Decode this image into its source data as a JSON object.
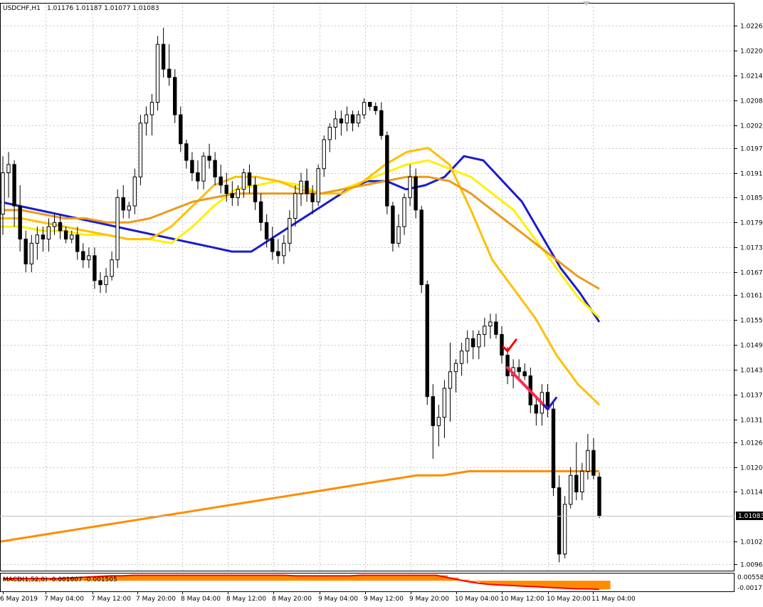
{
  "header": {
    "symbol_label": "USDCHF,H1",
    "ohlc_label": "1.01176 1.01187 1.01077 1.01083"
  },
  "macd_label": "MACD(1,52,0) -0.001607 -0.001505",
  "colors": {
    "background": "#ffffff",
    "grid": "#c8c8c8",
    "axis": "#000000",
    "bull_fill": "#ffffff",
    "bear_fill": "#000000",
    "ma_blue": "#1c1ccc",
    "ma_yellow": "#fff000",
    "ma_gold": "#ffc000",
    "ma_orange": "#ec9a1c",
    "ma_long": "#ff8c00",
    "macd_line": "#ff0000",
    "macd_hist": "#ff8c00",
    "price_tag_bg": "#000000",
    "price_tag_text": "#ffffff"
  },
  "chart_data": [
    {
      "type": "candlestick",
      "title": "USDCHF,H1",
      "ylim": [
        1.0095,
        1.0232
      ],
      "y_ticks": [
        "1.02265",
        "1.02205",
        "1.02145",
        "1.02085",
        "1.02025",
        "1.01970",
        "1.01910",
        "1.01850",
        "1.01790",
        "1.01730",
        "1.01670",
        "1.01615",
        "1.01555",
        "1.01495",
        "1.01435",
        "1.01375",
        "1.01315",
        "1.01260",
        "1.01200",
        "1.01140",
        "1.01020",
        "1.00965"
      ],
      "current_price": "1.01083",
      "x_ticks": [
        "6 May 2019",
        "7 May 04:00",
        "7 May 12:00",
        "7 May 20:00",
        "8 May 04:00",
        "8 May 12:00",
        "8 May 20:00",
        "9 May 04:00",
        "9 May 12:00",
        "9 May 20:00",
        "10 May 04:00",
        "10 May 12:00",
        "10 May 20:00",
        "11 May 04:00"
      ],
      "candles": [
        [
          1.0181,
          1.0195,
          1.0176,
          1.0191
        ],
        [
          1.0191,
          1.0196,
          1.0185,
          1.0193
        ],
        [
          1.0193,
          1.0194,
          1.0178,
          1.0183
        ],
        [
          1.0183,
          1.0188,
          1.0172,
          1.0175
        ],
        [
          1.0175,
          1.0177,
          1.0167,
          1.0169
        ],
        [
          1.0169,
          1.0176,
          1.0167,
          1.0174
        ],
        [
          1.0174,
          1.0178,
          1.017,
          1.0176
        ],
        [
          1.0176,
          1.0178,
          1.0172,
          1.0175
        ],
        [
          1.0175,
          1.018,
          1.0172,
          1.0178
        ],
        [
          1.0178,
          1.0181,
          1.0176,
          1.0179
        ],
        [
          1.0179,
          1.0181,
          1.0175,
          1.0177
        ],
        [
          1.0177,
          1.0178,
          1.0174,
          1.0175
        ],
        [
          1.0175,
          1.0177,
          1.0174,
          1.0176
        ],
        [
          1.0176,
          1.0178,
          1.017,
          1.0172
        ],
        [
          1.0172,
          1.0174,
          1.0168,
          1.017
        ],
        [
          1.017,
          1.0173,
          1.0168,
          1.0171
        ],
        [
          1.0171,
          1.0173,
          1.0163,
          1.0165
        ],
        [
          1.0165,
          1.0167,
          1.0162,
          1.0164
        ],
        [
          1.0164,
          1.0168,
          1.0162,
          1.0166
        ],
        [
          1.0166,
          1.0172,
          1.0165,
          1.017
        ],
        [
          1.017,
          1.0187,
          1.0168,
          1.0185
        ],
        [
          1.0185,
          1.0188,
          1.018,
          1.0182
        ],
        [
          1.0182,
          1.0184,
          1.018,
          1.0183
        ],
        [
          1.0183,
          1.0192,
          1.0181,
          1.019
        ],
        [
          1.019,
          1.0205,
          1.0188,
          1.0203
        ],
        [
          1.0203,
          1.0207,
          1.02,
          1.0205
        ],
        [
          1.0205,
          1.021,
          1.02,
          1.0208
        ],
        [
          1.0208,
          1.0224,
          1.0206,
          1.0222
        ],
        [
          1.0222,
          1.0226,
          1.0214,
          1.0216
        ],
        [
          1.0216,
          1.0222,
          1.0212,
          1.0214
        ],
        [
          1.0214,
          1.0216,
          1.0203,
          1.0205
        ],
        [
          1.0205,
          1.0207,
          1.0196,
          1.0198
        ],
        [
          1.0198,
          1.0199,
          1.0192,
          1.0194
        ],
        [
          1.0194,
          1.0196,
          1.0189,
          1.0191
        ],
        [
          1.0191,
          1.0194,
          1.0187,
          1.0189
        ],
        [
          1.0189,
          1.0196,
          1.0187,
          1.0195
        ],
        [
          1.0195,
          1.0198,
          1.0192,
          1.0194
        ],
        [
          1.0194,
          1.0196,
          1.0188,
          1.019
        ],
        [
          1.019,
          1.0193,
          1.0186,
          1.0188
        ],
        [
          1.0188,
          1.0191,
          1.0184,
          1.0186
        ],
        [
          1.0186,
          1.0189,
          1.0183,
          1.0185
        ],
        [
          1.0185,
          1.0188,
          1.0183,
          1.0187
        ],
        [
          1.0187,
          1.0192,
          1.0185,
          1.0191
        ],
        [
          1.0191,
          1.0193,
          1.0186,
          1.0188
        ],
        [
          1.0188,
          1.019,
          1.0182,
          1.0184
        ],
        [
          1.0184,
          1.0186,
          1.0177,
          1.0179
        ],
        [
          1.0179,
          1.0181,
          1.0173,
          1.0175
        ],
        [
          1.0175,
          1.0178,
          1.017,
          1.0172
        ],
        [
          1.0172,
          1.0175,
          1.0169,
          1.0171
        ],
        [
          1.0171,
          1.0176,
          1.0169,
          1.0174
        ],
        [
          1.0174,
          1.0182,
          1.0172,
          1.018
        ],
        [
          1.018,
          1.0188,
          1.0178,
          1.0186
        ],
        [
          1.0186,
          1.0191,
          1.0183,
          1.0189
        ],
        [
          1.0189,
          1.0192,
          1.0184,
          1.0186
        ],
        [
          1.0186,
          1.0188,
          1.0181,
          1.0184
        ],
        [
          1.0184,
          1.0193,
          1.0183,
          1.0192
        ],
        [
          1.0192,
          1.02,
          1.019,
          1.0199
        ],
        [
          1.0199,
          1.0203,
          1.0196,
          1.0202
        ],
        [
          1.0202,
          1.0206,
          1.0199,
          1.0204
        ],
        [
          1.0204,
          1.0206,
          1.02,
          1.0203
        ],
        [
          1.0203,
          1.0207,
          1.0201,
          1.0205
        ],
        [
          1.0205,
          1.0206,
          1.0201,
          1.0203
        ],
        [
          1.0203,
          1.0206,
          1.0202,
          1.0205
        ],
        [
          1.0205,
          1.0209,
          1.0204,
          1.0208
        ],
        [
          1.0208,
          1.0208,
          1.0206,
          1.0207
        ],
        [
          1.0207,
          1.0208,
          1.0205,
          1.0206
        ],
        [
          1.0206,
          1.0208,
          1.0199,
          1.02
        ],
        [
          1.02,
          1.0201,
          1.0181,
          1.0183
        ],
        [
          1.0183,
          1.0184,
          1.0172,
          1.0174
        ],
        [
          1.0174,
          1.0181,
          1.0173,
          1.0178
        ],
        [
          1.0178,
          1.0186,
          1.0176,
          1.0185
        ],
        [
          1.0185,
          1.0193,
          1.0183,
          1.019
        ],
        [
          1.019,
          1.0192,
          1.018,
          1.0182
        ],
        [
          1.0182,
          1.0183,
          1.0162,
          1.0164
        ],
        [
          1.0164,
          1.0165,
          1.0135,
          1.0137
        ],
        [
          1.0137,
          1.014,
          1.0122,
          1.013
        ],
        [
          1.013,
          1.0135,
          1.0125,
          1.0132
        ],
        [
          1.0132,
          1.0141,
          1.0127,
          1.0139
        ],
        [
          1.0139,
          1.015,
          1.0131,
          1.0143
        ],
        [
          1.0143,
          1.0146,
          1.0138,
          1.0145
        ],
        [
          1.0145,
          1.015,
          1.0142,
          1.0148
        ],
        [
          1.0148,
          1.0153,
          1.0145,
          1.0151
        ],
        [
          1.0151,
          1.0153,
          1.0146,
          1.0149
        ],
        [
          1.0149,
          1.0153,
          1.0146,
          1.0152
        ],
        [
          1.0152,
          1.0156,
          1.0149,
          1.0154
        ],
        [
          1.0154,
          1.0157,
          1.0151,
          1.0155
        ],
        [
          1.0155,
          1.0157,
          1.0151,
          1.0152
        ],
        [
          1.0152,
          1.0154,
          1.0145,
          1.0147
        ],
        [
          1.0147,
          1.0149,
          1.014,
          1.0142
        ],
        [
          1.0142,
          1.0146,
          1.0139,
          1.0144
        ],
        [
          1.0144,
          1.0146,
          1.0141,
          1.0143
        ],
        [
          1.0143,
          1.0145,
          1.0141,
          1.0142
        ],
        [
          1.0142,
          1.0144,
          1.0133,
          1.0135
        ],
        [
          1.0135,
          1.0137,
          1.013,
          1.0133
        ],
        [
          1.0133,
          1.014,
          1.013,
          1.0138
        ],
        [
          1.0138,
          1.014,
          1.0132,
          1.0134
        ],
        [
          1.0134,
          1.0136,
          1.0113,
          1.0115
        ],
        [
          1.0115,
          1.0118,
          1.0097,
          1.0099
        ],
        [
          1.0099,
          1.0113,
          1.0098,
          1.0111
        ],
        [
          1.0111,
          1.012,
          1.011,
          1.0118
        ],
        [
          1.0118,
          1.0126,
          1.0112,
          1.0114
        ],
        [
          1.0114,
          1.0121,
          1.0112,
          1.0119
        ],
        [
          1.0119,
          1.0128,
          1.0117,
          1.0124
        ],
        [
          1.0124,
          1.0127,
          1.0117,
          1.0118
        ],
        [
          1.01176,
          1.01187,
          1.01077,
          1.01083
        ]
      ],
      "moving_averages": [
        {
          "color_key": "ma_blue",
          "values": [
            1.0184,
            1.0183,
            1.0182,
            1.0181,
            1.018,
            1.0179,
            1.0178,
            1.0177,
            1.0176,
            1.0175,
            1.0174,
            1.0173,
            1.0172,
            1.0172,
            1.0175,
            1.0178,
            1.0181,
            1.0184,
            1.0187,
            1.0189,
            1.0189,
            1.0187,
            1.0188,
            1.019,
            1.0195,
            1.0194,
            1.0189,
            1.0184,
            1.0176,
            1.0168,
            1.0162,
            1.0155
          ]
        },
        {
          "color_key": "ma_yellow",
          "values": [
            1.0178,
            1.0178,
            1.0177,
            1.0177,
            1.0176,
            1.0176,
            1.0175,
            1.0175,
            1.0174,
            1.0178,
            1.0183,
            1.0187,
            1.0188,
            1.0189,
            1.0188,
            1.0186,
            1.0187,
            1.0189,
            1.0191,
            1.0193,
            1.0194,
            1.0192,
            1.019,
            1.0186,
            1.0182,
            1.0175,
            1.0168,
            1.0161,
            1.0156
          ]
        },
        {
          "color_key": "ma_gold",
          "values": [
            1.018,
            1.018,
            1.0179,
            1.0178,
            1.0177,
            1.0176,
            1.0175,
            1.0175,
            1.0178,
            1.0183,
            1.0188,
            1.019,
            1.019,
            1.0189,
            1.0187,
            1.0186,
            1.0186,
            1.0189,
            1.0193,
            1.0196,
            1.0197,
            1.0193,
            1.0182,
            1.017,
            1.0163,
            1.0156,
            1.0147,
            1.014,
            1.0135
          ]
        },
        {
          "color_key": "ma_orange",
          "values": [
            1.0182,
            1.0182,
            1.0181,
            1.018,
            1.018,
            1.0179,
            1.0179,
            1.018,
            1.0182,
            1.0184,
            1.0185,
            1.0186,
            1.0186,
            1.0186,
            1.0186,
            1.0186,
            1.0187,
            1.0188,
            1.0189,
            1.019,
            1.019,
            1.0189,
            1.0186,
            1.0182,
            1.0178,
            1.0174,
            1.017,
            1.0166,
            1.0163
          ]
        },
        {
          "color_key": "ma_long",
          "values": [
            1.0102,
            1.0103,
            1.0104,
            1.0105,
            1.0106,
            1.0107,
            1.0108,
            1.0109,
            1.011,
            1.0111,
            1.0112,
            1.0113,
            1.0114,
            1.0115,
            1.0116,
            1.0117,
            1.0118,
            1.0118,
            1.0119,
            1.0119,
            1.0119,
            1.0119,
            1.0119,
            1.0119
          ]
        }
      ],
      "annotations": [
        {
          "type": "check",
          "color": "#ff0000",
          "bar_index": 88,
          "price": 1.0149
        },
        {
          "type": "arrow-line",
          "color": "#ff2a4a",
          "from_bar": 88,
          "from_price": 1.0144,
          "to_bar": 95,
          "to_price": 1.0134
        },
        {
          "type": "check",
          "color": "#1c1ccc",
          "bar_index": 95,
          "price": 1.0135
        }
      ]
    },
    {
      "type": "macd",
      "title": "MACD(1,52,0)",
      "y_ticks": [
        "0.005583",
        "-0.00171"
      ],
      "values": [
        0.0004,
        0.0004,
        0.0004,
        0.0004,
        0.0004,
        0.0004,
        0.0005,
        0.0006,
        0.0007,
        0.0008,
        0.0009,
        0.0009,
        0.001,
        0.001,
        0.001,
        0.001,
        0.001,
        0.001,
        0.001,
        0.001,
        0.001,
        0.001,
        0.001,
        0.001,
        0.001,
        0.001,
        0.001,
        0.0009,
        0.0009,
        0.0009,
        0.0009,
        0.0009,
        0.0009,
        0.001,
        0.001,
        0.001,
        0.001,
        0.001,
        0.001,
        0.001,
        0.001,
        0.0006,
        0.0002,
        -0.0002,
        -0.0005,
        -0.0007,
        -0.0008,
        -0.0009,
        -0.001,
        -0.0011,
        -0.0012,
        -0.0013,
        -0.0014,
        -0.0015,
        -0.0015,
        -0.0016
      ]
    }
  ]
}
